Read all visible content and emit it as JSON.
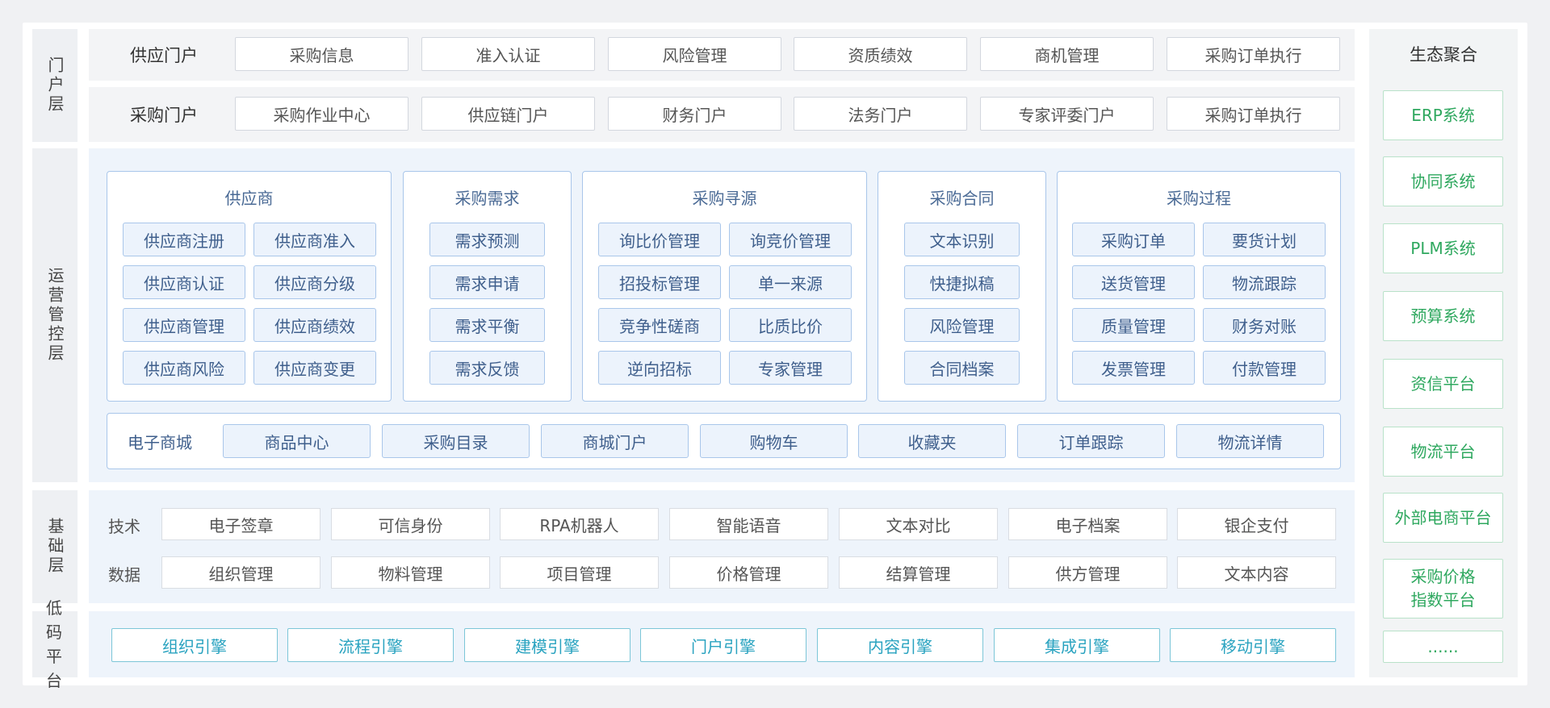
{
  "layers": {
    "portal": "门户层",
    "operation": "运营管控层",
    "foundation": "基础层",
    "lowcode": "低码平台"
  },
  "portal": {
    "rows": [
      {
        "label": "供应门户",
        "items": [
          "采购信息",
          "准入认证",
          "风险管理",
          "资质绩效",
          "商机管理",
          "采购订单执行"
        ]
      },
      {
        "label": "采购门户",
        "items": [
          "采购作业中心",
          "供应链门户",
          "财务门户",
          "法务门户",
          "专家评委门户",
          "采购订单执行"
        ]
      }
    ]
  },
  "operation": {
    "groups": [
      {
        "title": "供应商",
        "items": [
          "供应商注册",
          "供应商准入",
          "供应商认证",
          "供应商分级",
          "供应商管理",
          "供应商绩效",
          "供应商风险",
          "供应商变更"
        ]
      },
      {
        "title": "采购需求",
        "items": [
          "需求预测",
          "需求申请",
          "需求平衡",
          "需求反馈"
        ]
      },
      {
        "title": "采购寻源",
        "items": [
          "询比价管理",
          "询竞价管理",
          "招投标管理",
          "单一来源",
          "竞争性磋商",
          "比质比价",
          "逆向招标",
          "专家管理"
        ]
      },
      {
        "title": "采购合同",
        "items": [
          "文本识别",
          "快捷拟稿",
          "风险管理",
          "合同档案"
        ]
      },
      {
        "title": "采购过程",
        "items": [
          "采购订单",
          "要货计划",
          "送货管理",
          "物流跟踪",
          "质量管理",
          "财务对账",
          "发票管理",
          "付款管理"
        ]
      }
    ],
    "mall": {
      "label": "电子商城",
      "items": [
        "商品中心",
        "采购目录",
        "商城门户",
        "购物车",
        "收藏夹",
        "订单跟踪",
        "物流详情"
      ]
    }
  },
  "foundation": {
    "rows": [
      {
        "label": "技术",
        "items": [
          "电子签章",
          "可信身份",
          "RPA机器人",
          "智能语音",
          "文本对比",
          "电子档案",
          "银企支付"
        ]
      },
      {
        "label": "数据",
        "items": [
          "组织管理",
          "物料管理",
          "项目管理",
          "价格管理",
          "结算管理",
          "供方管理",
          "文本内容"
        ]
      }
    ]
  },
  "lowcode": {
    "items": [
      "组织引擎",
      "流程引擎",
      "建模引擎",
      "门户引擎",
      "内容引擎",
      "集成引擎",
      "移动引擎"
    ]
  },
  "ecosystem": {
    "title": "生态聚合",
    "items": [
      "ERP系统",
      "协同系统",
      "PLM系统",
      "预算系统",
      "资信平台",
      "物流平台",
      "外部电商平台",
      "采购价格\n指数平台",
      "......"
    ]
  },
  "colors": {
    "chip_border": "#a9c6ea",
    "chip_fill": "#ecf3fc",
    "engine_text": "#2aa3c0",
    "eco_text": "#2fa85f"
  }
}
